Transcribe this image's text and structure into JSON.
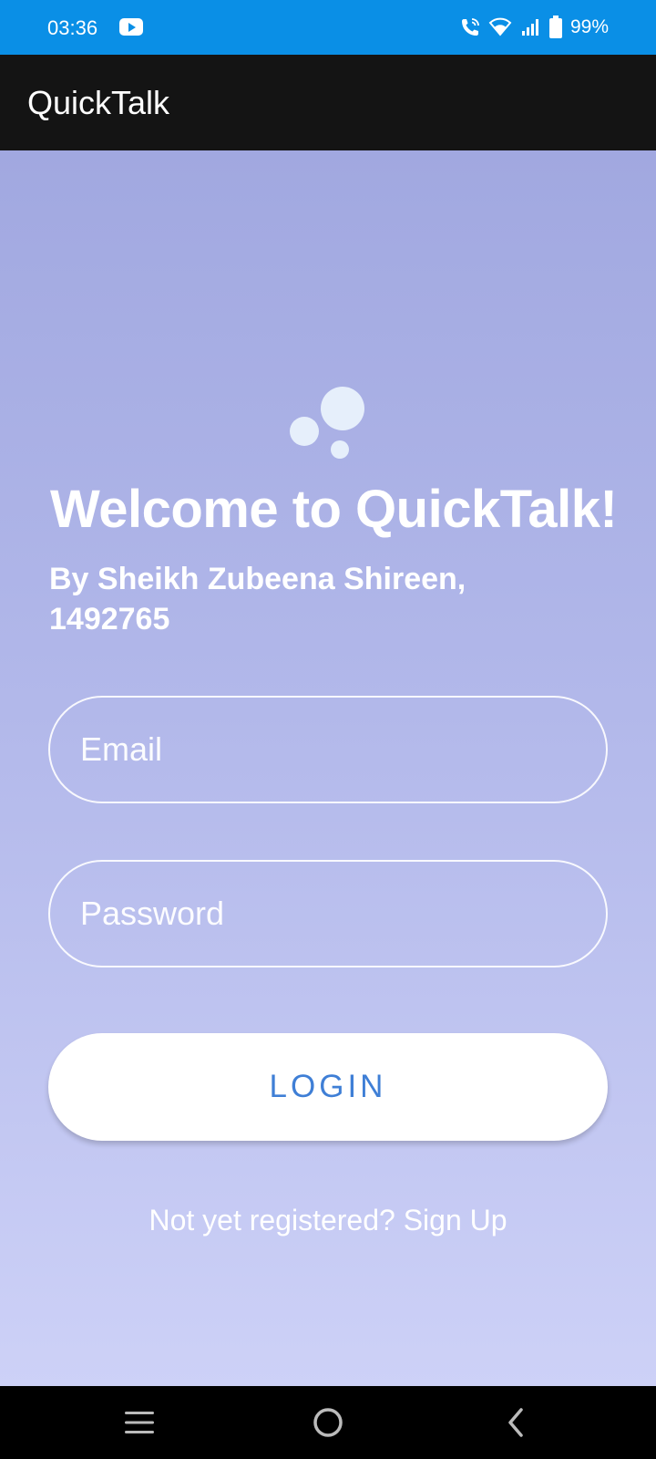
{
  "status_bar": {
    "time": "03:36",
    "battery": "99%",
    "icons": [
      "youtube-icon",
      "wifi-call-icon",
      "wifi-icon",
      "signal-icon",
      "battery-icon"
    ]
  },
  "app_bar": {
    "title": "QuickTalk"
  },
  "login": {
    "welcome": "Welcome to QuickTalk!",
    "subtitle": "By Sheikh Zubeena Shireen, 1492765",
    "email_placeholder": "Email",
    "password_placeholder": "Password",
    "login_label": "LOGIN",
    "signup_text": "Not yet registered? Sign Up"
  },
  "nav_bar": {
    "icons": [
      "recents-icon",
      "home-icon",
      "back-icon"
    ]
  },
  "colors": {
    "status_bar": "#0a8fe6",
    "app_bar": "#141414",
    "gradient_top": "#a1a8e0",
    "gradient_bottom": "#cdd1f7",
    "button_text": "#3f7fd6"
  }
}
